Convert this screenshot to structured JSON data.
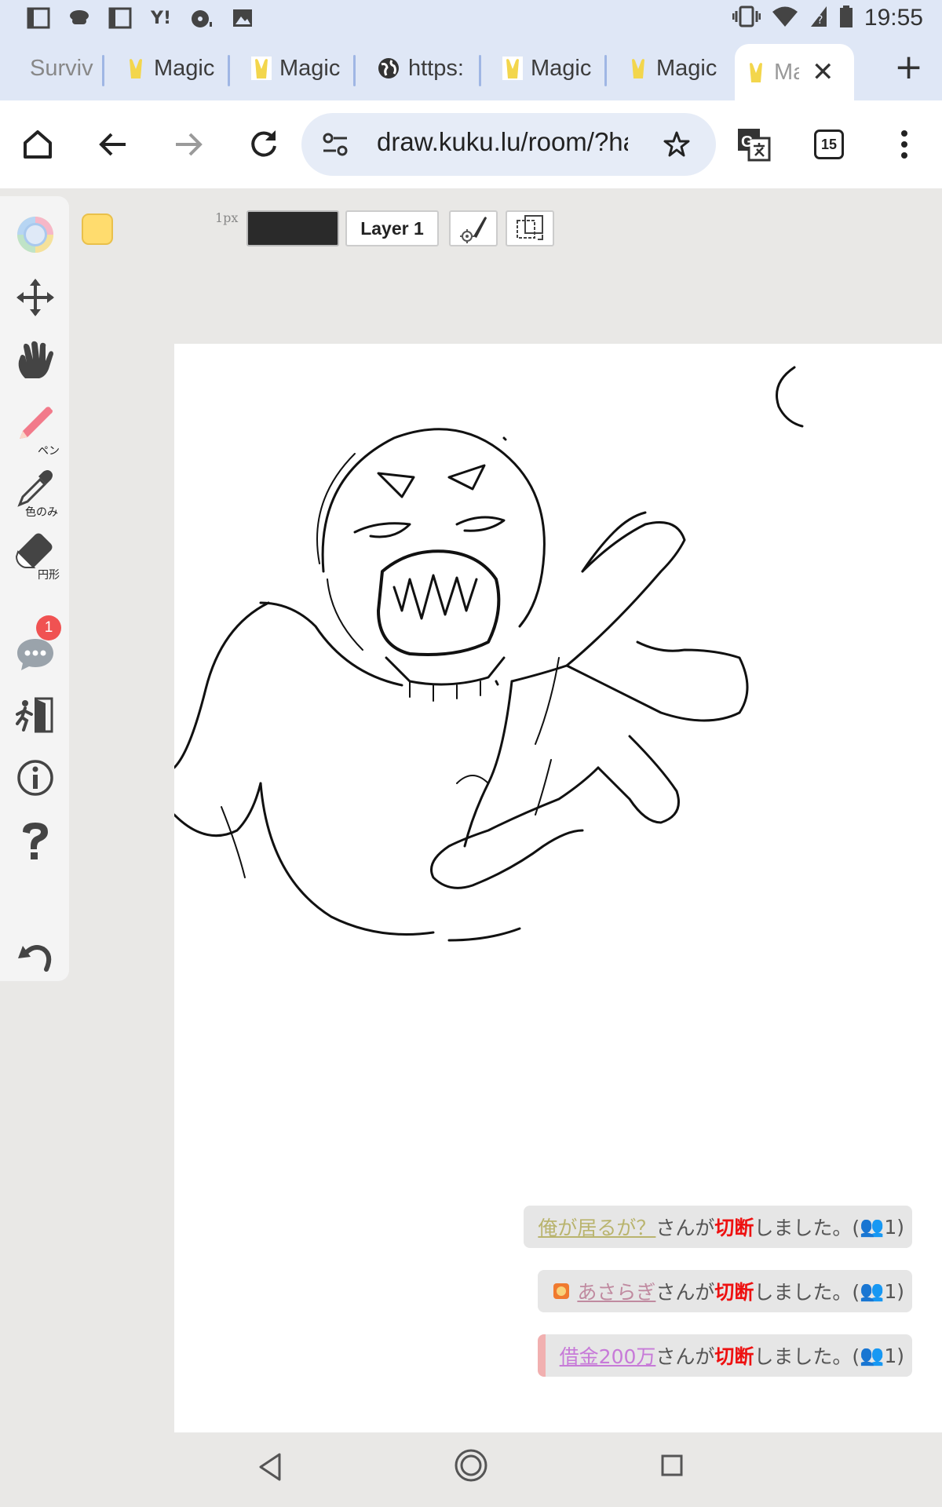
{
  "status_bar": {
    "time": "19:55",
    "notification_icons": [
      "au-icon",
      "cup-icon",
      "au-icon",
      "yahoo-icon",
      "music-icon",
      "image-icon"
    ],
    "yahoo_text": "Y!"
  },
  "tabs": [
    {
      "label": "Surviv",
      "icon": "none",
      "faded": true
    },
    {
      "label": "Magic",
      "icon": "bunny-favicon"
    },
    {
      "label": "Magic",
      "icon": "bunny-favicon"
    },
    {
      "label": "https:",
      "icon": "globe-icon"
    },
    {
      "label": "Magic",
      "icon": "bunny-favicon"
    },
    {
      "label": "Magic",
      "icon": "bunny-favicon"
    },
    {
      "label": "Ma",
      "icon": "bunny-favicon",
      "active": true
    }
  ],
  "toolbar": {
    "url": "draw.kuku.lu/room/?ha",
    "tab_count": "15"
  },
  "tools": {
    "pen_label": "ペン",
    "eyedropper_label": "色のみ",
    "eraser_label": "円形",
    "chat_badge": "1"
  },
  "controls": {
    "size_label": "1px",
    "layer_label": "Layer 1",
    "swatch_color": "#ffdc6e",
    "stroke_color": "#2a2a2a"
  },
  "notices": [
    {
      "user": "俺が居るが？",
      "middle": "さんが",
      "action": "切断",
      "suffix": "しました。(",
      "count": "1)",
      "user_color": "#b9b46e",
      "has_icon": false
    },
    {
      "user": "あさらぎ",
      "middle": "さんが",
      "action": "切断",
      "suffix": "しました。(",
      "count": "1)",
      "user_color": "#c08aa0",
      "has_icon": true
    },
    {
      "user": "借金200万",
      "middle": "さんが",
      "action": "切断",
      "suffix": "しました。(",
      "count": "1)",
      "user_color": "#c77ad8",
      "has_icon": false
    }
  ]
}
